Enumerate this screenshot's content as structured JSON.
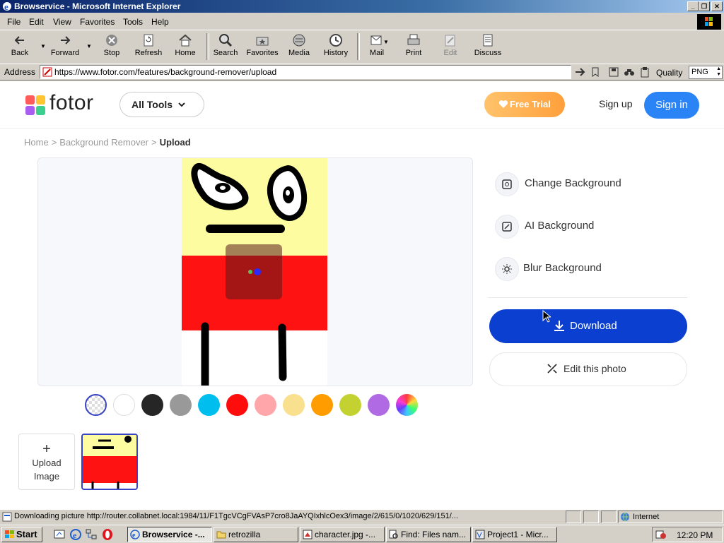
{
  "window": {
    "title": "Browservice - Microsoft Internet Explorer"
  },
  "menu": [
    "File",
    "Edit",
    "View",
    "Favorites",
    "Tools",
    "Help"
  ],
  "toolbar": {
    "back": "Back",
    "forward": "Forward",
    "stop": "Stop",
    "refresh": "Refresh",
    "home": "Home",
    "search": "Search",
    "favorites": "Favorites",
    "media": "Media",
    "history": "History",
    "mail": "Mail",
    "print": "Print",
    "edit": "Edit",
    "discuss": "Discuss"
  },
  "address": {
    "label": "Address",
    "url": "https://www.fotor.com/features/background-remover/upload",
    "quality_label": "Quality",
    "quality_value": "PNG"
  },
  "site": {
    "logo": "fotor",
    "all_tools": "All Tools",
    "free_trial": "Free Trial",
    "sign_up": "Sign up",
    "sign_in": "Sign in"
  },
  "breadcrumb": {
    "home": "Home",
    "section": "Background Remover",
    "current": "Upload",
    "sep": ">"
  },
  "options": {
    "change_bg": "Change Background",
    "ai_bg": "AI Background",
    "blur_bg": "Blur Background"
  },
  "actions": {
    "download": "Download",
    "edit_photo": "Edit this photo"
  },
  "upload": {
    "plus": "+",
    "line1": "Upload",
    "line2": "Image"
  },
  "swatch_colors": [
    "transparent",
    "#ffffff",
    "#262626",
    "#999999",
    "#00bfef",
    "#ff0d0d",
    "#ffa6ab",
    "#f8e08e",
    "#ff9d00",
    "#c3d230",
    "#b06be4",
    "rainbow"
  ],
  "statusbar": {
    "text": "Downloading picture http://router.collabnet.local:1984/11/F1TgcVCgFVAsP7cro8JaAYQIxhlcOex3/image/2/615/0/1020/629/151/...",
    "zone": "Internet"
  },
  "taskbar": {
    "start": "Start",
    "tasks": [
      "Browservice -...",
      "retrozilla",
      "character.jpg -...",
      "Find: Files nam...",
      "Project1 - Micr..."
    ],
    "clock": "12:20 PM"
  }
}
